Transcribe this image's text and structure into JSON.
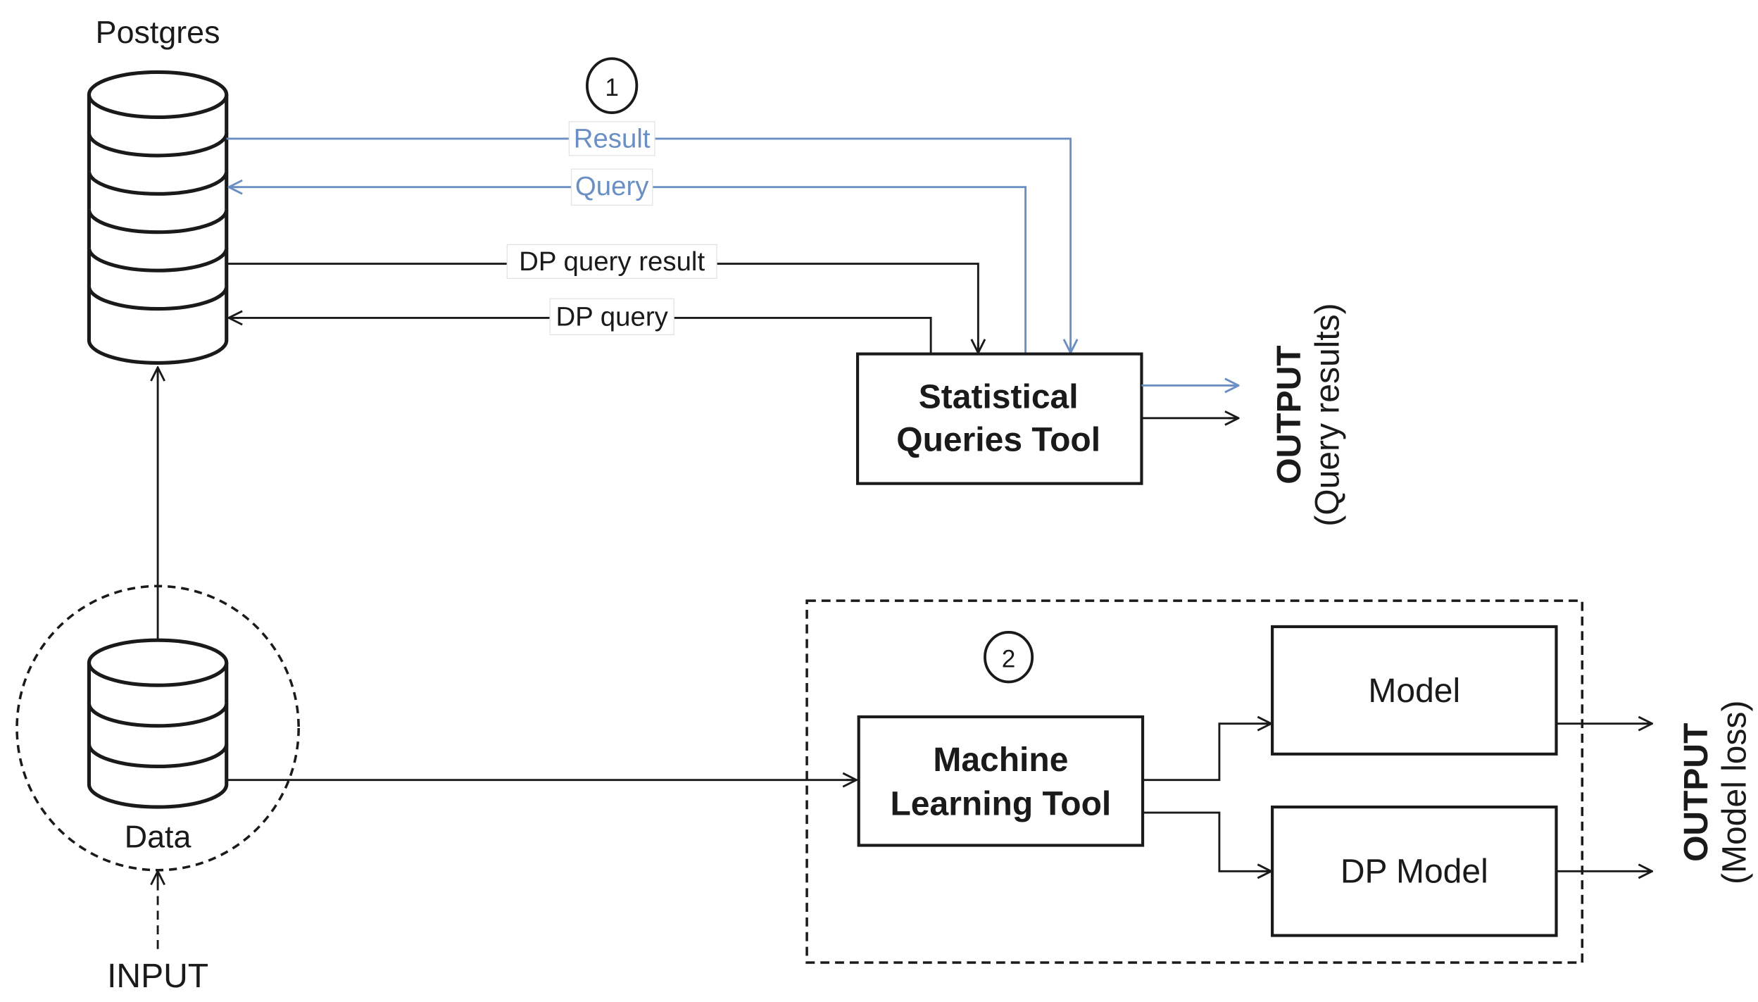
{
  "diagram": {
    "nodes": {
      "postgres": {
        "label": "Postgres",
        "shape": "database-icon"
      },
      "data": {
        "label": "Data",
        "shape": "database-icon"
      },
      "input": {
        "label": "INPUT"
      },
      "stat_tool": {
        "line1": "Statistical",
        "line2": "Queries Tool"
      },
      "ml_tool": {
        "line1": "Machine",
        "line2": "Learning Tool"
      },
      "model": {
        "label": "Model"
      },
      "dp_model": {
        "label": "DP Model"
      },
      "output_query": {
        "title": "OUTPUT",
        "subtitle": "(Query results)"
      },
      "output_model": {
        "title": "OUTPUT",
        "subtitle": "(Model loss)"
      }
    },
    "markers": {
      "step1": "1",
      "step2": "2"
    },
    "edges": {
      "result": {
        "label": "Result",
        "color": "#6b8fc2"
      },
      "query": {
        "label": "Query",
        "color": "#6b8fc2"
      },
      "dp_query_result": {
        "label": "DP query result",
        "color": "#1a1a1a"
      },
      "dp_query": {
        "label": "DP query",
        "color": "#1a1a1a"
      }
    },
    "colors": {
      "accent_blue": "#6b8fc2",
      "ink": "#1a1a1a"
    }
  }
}
